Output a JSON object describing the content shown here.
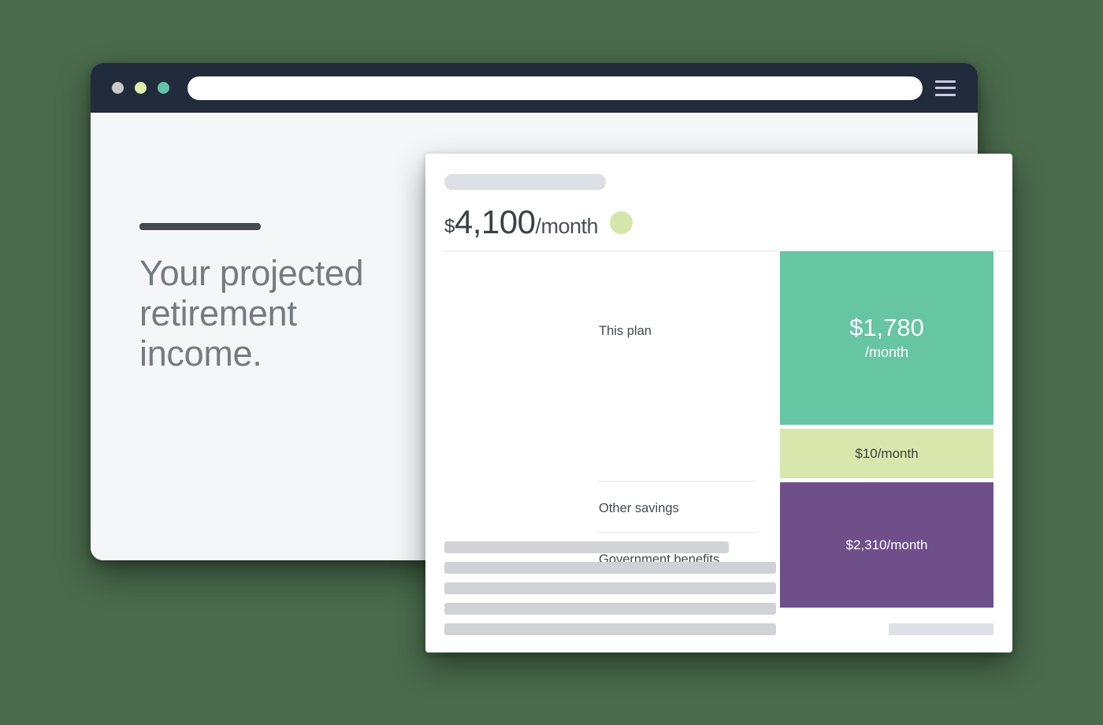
{
  "background_color": "#4a6b4c",
  "browser": {
    "titlebar_color": "#222b3c",
    "traffic_lights": [
      {
        "name": "close",
        "color": "#c9c9c9"
      },
      {
        "name": "minimize",
        "color": "#e0ecaa"
      },
      {
        "name": "maximize",
        "color": "#63c5a2"
      }
    ],
    "url_value": "",
    "url_placeholder": "",
    "menu_icon": "hamburger-menu-icon"
  },
  "page": {
    "eyebrow_rule": "",
    "headline": "Your projected retirement income."
  },
  "card": {
    "skeleton_title": "",
    "total": {
      "currency": "$",
      "value": "4,100",
      "period": "/month",
      "status_dot_color": "#d6e6ab"
    },
    "breakdown": {
      "rows": [
        {
          "label": "This plan",
          "value": "$1,780",
          "period": "/month",
          "color": "#66c5a2",
          "amount": 1780
        },
        {
          "label": "Other savings",
          "value": "$10/month",
          "period": "",
          "color": "#d9e7ac",
          "amount": 10
        },
        {
          "label": "Government benefits",
          "value": "$2,310/month",
          "period": "",
          "color": "#6e4f89",
          "amount": 2310
        }
      ]
    },
    "footer": {
      "skeleton_line_count": 5,
      "chip": ""
    }
  }
}
